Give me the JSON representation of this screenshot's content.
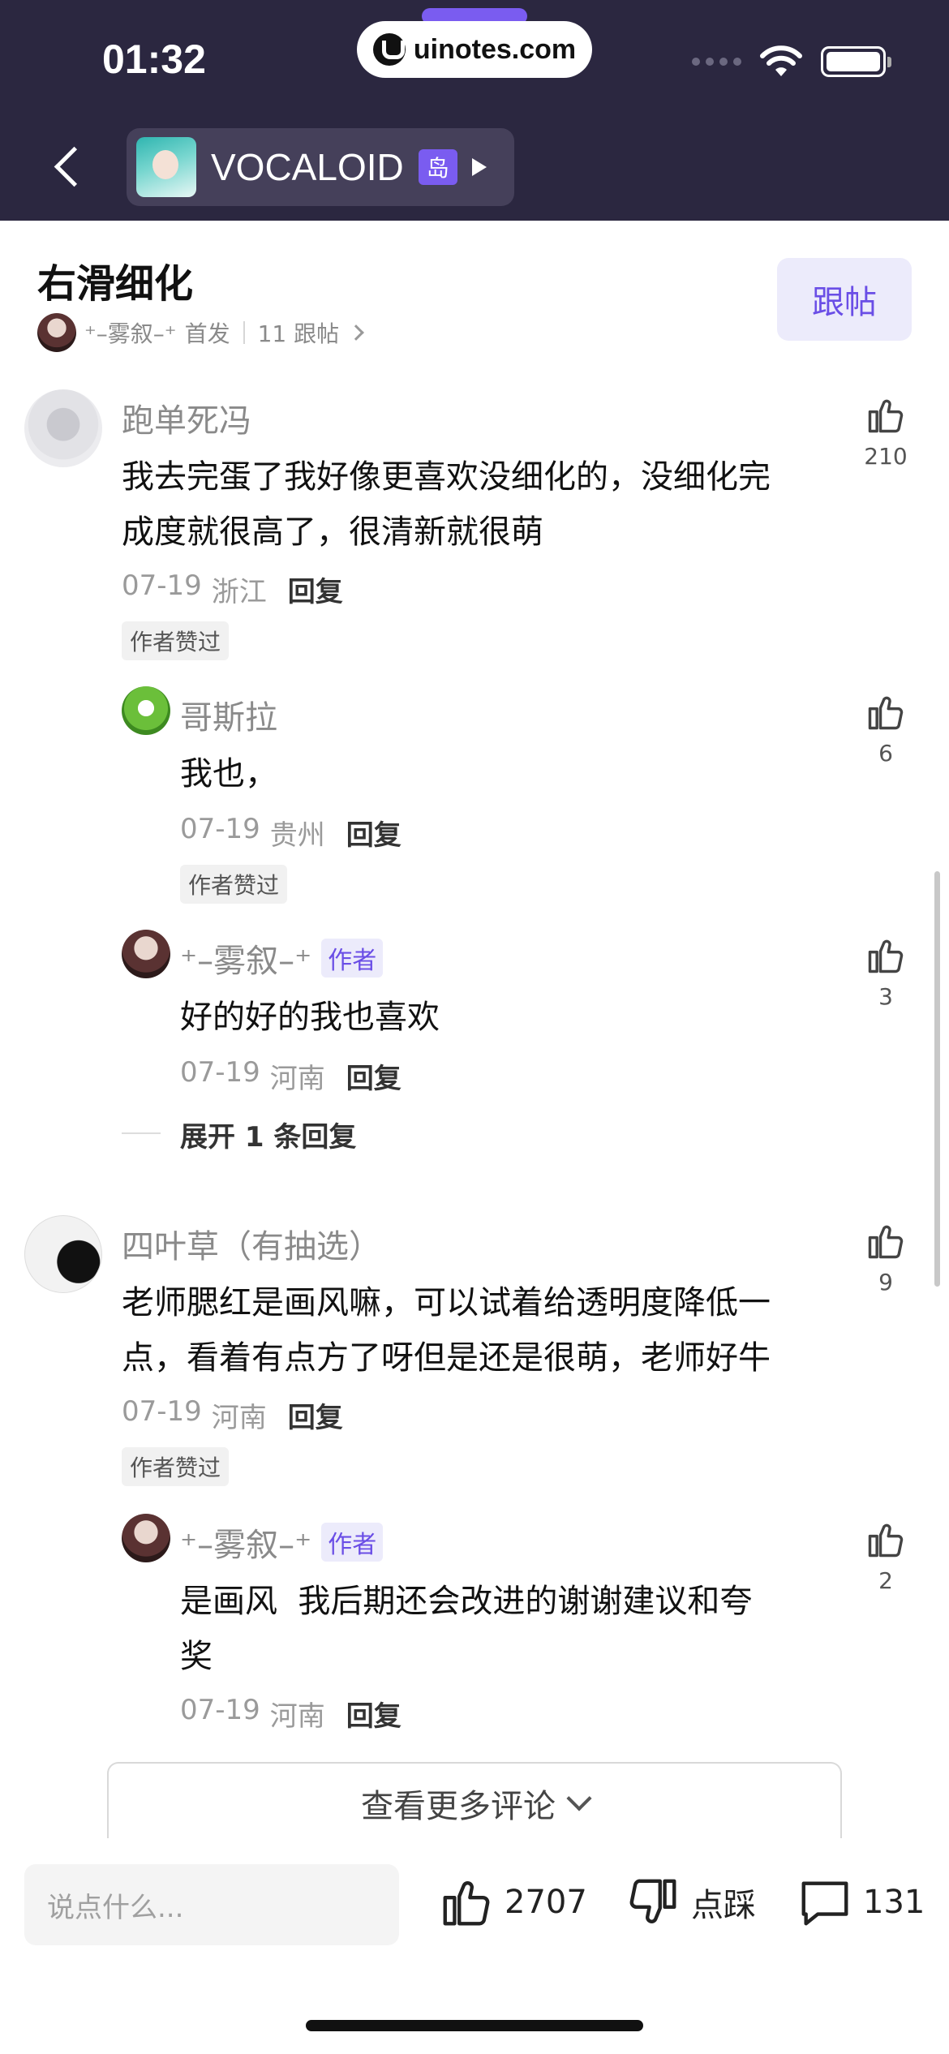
{
  "status_bar": {
    "time": "01:32",
    "watermark": "uinotes.com"
  },
  "header": {
    "forum_name": "VOCALOID",
    "island_badge": "岛"
  },
  "post": {
    "title": "右滑细化",
    "author": "⁺–雾叙–⁺",
    "first_post_label": "首发",
    "follow_count": "11 跟帖",
    "follow_button": "跟帖"
  },
  "comments": [
    {
      "name": "跑单死冯",
      "text_lines": [
        "我去完蛋了我好像更喜欢没细化的，没细化完",
        "成度就很高了，很清新就很萌"
      ],
      "date": "07-19",
      "location": "浙江",
      "reply": "回复",
      "liked_tag": "作者赞过",
      "likes": "210",
      "replies": [
        {
          "name": "哥斯拉",
          "text": "我也，",
          "date": "07-19",
          "location": "贵州",
          "reply": "回复",
          "liked_tag": "作者赞过",
          "likes": "6"
        },
        {
          "name": "⁺–雾叙–⁺",
          "author_tag": "作者",
          "text": "好的好的我也喜欢",
          "date": "07-19",
          "location": "河南",
          "reply": "回复",
          "likes": "3"
        }
      ],
      "expand_label": "展开 1 条回复"
    },
    {
      "name": "四叶草（有抽选）",
      "text_lines": [
        "老师腮红是画风嘛，可以试着给透明度降低一",
        "点，看着有点方了呀但是还是很萌，老师好牛"
      ],
      "date": "07-19",
      "location": "河南",
      "reply": "回复",
      "liked_tag": "作者赞过",
      "likes": "9",
      "replies": [
        {
          "name": "⁺–雾叙–⁺",
          "author_tag": "作者",
          "text_lines": [
            "是画风  我后期还会改进的谢谢建议和夸",
            "奖"
          ],
          "date": "07-19",
          "location": "河南",
          "reply": "回复",
          "likes": "2"
        }
      ]
    }
  ],
  "more_comments_label": "查看更多评论",
  "bottom_bar": {
    "input_placeholder": "说点什么...",
    "like_count": "2707",
    "dislike_label": "点踩",
    "comment_count": "131"
  },
  "colors": {
    "header_bg": "#2b2740",
    "accent": "#6a4ee6",
    "accent_bg": "#ecebfb"
  },
  "icons": [
    "back-arrow-icon",
    "play-icon",
    "thumb-up-icon",
    "thumb-down-icon",
    "comment-icon",
    "chevron-down-icon",
    "wifi-icon",
    "battery-icon"
  ]
}
